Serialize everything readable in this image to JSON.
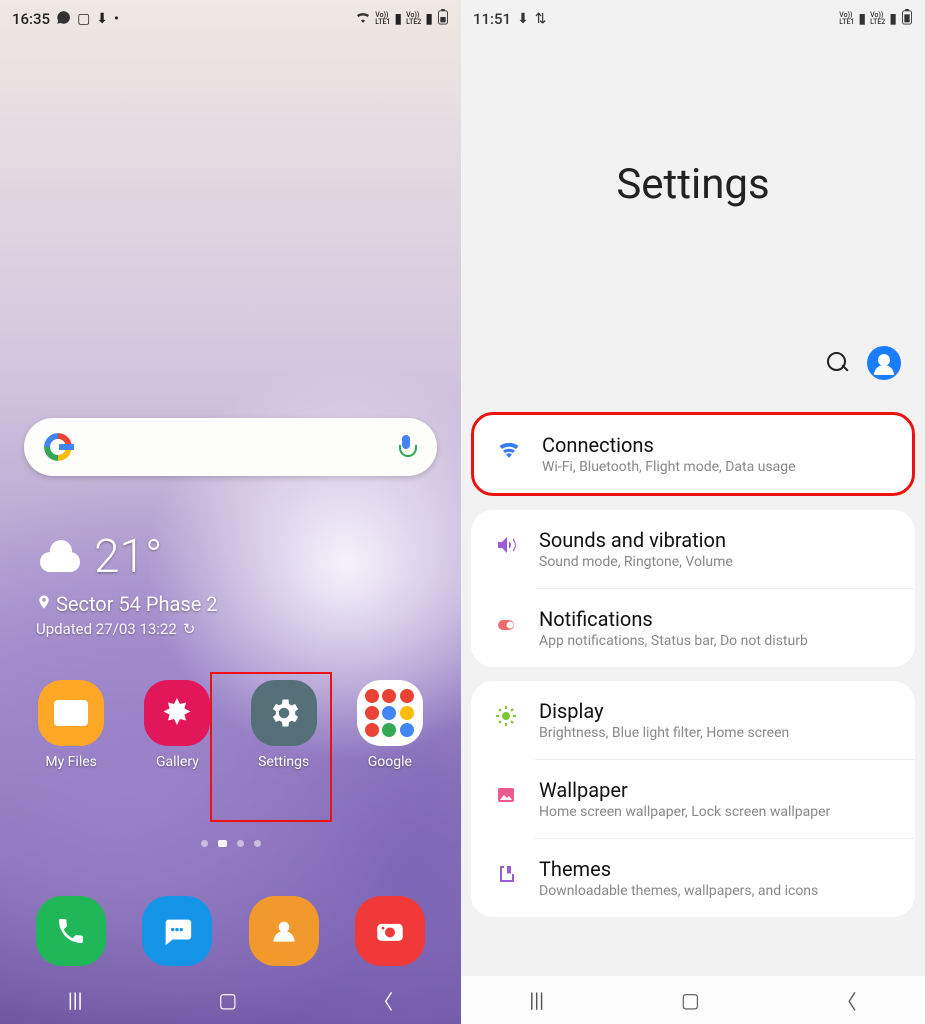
{
  "left": {
    "status": {
      "time": "16:35"
    },
    "weather": {
      "temp": "21°",
      "location": "Sector 54 Phase 2",
      "updated": "Updated 27/03 13:22"
    },
    "apps": {
      "files": "My Files",
      "gallery": "Gallery",
      "settings": "Settings",
      "google": "Google"
    }
  },
  "right": {
    "status": {
      "time": "11:51"
    },
    "title": "Settings",
    "items": [
      {
        "title": "Connections",
        "sub": "Wi-Fi, Bluetooth, Flight mode, Data usage"
      },
      {
        "title": "Sounds and vibration",
        "sub": "Sound mode, Ringtone, Volume"
      },
      {
        "title": "Notifications",
        "sub": "App notifications, Status bar, Do not disturb"
      },
      {
        "title": "Display",
        "sub": "Brightness, Blue light filter, Home screen"
      },
      {
        "title": "Wallpaper",
        "sub": "Home screen wallpaper, Lock screen wallpaper"
      },
      {
        "title": "Themes",
        "sub": "Downloadable themes, wallpapers, and icons"
      }
    ]
  }
}
